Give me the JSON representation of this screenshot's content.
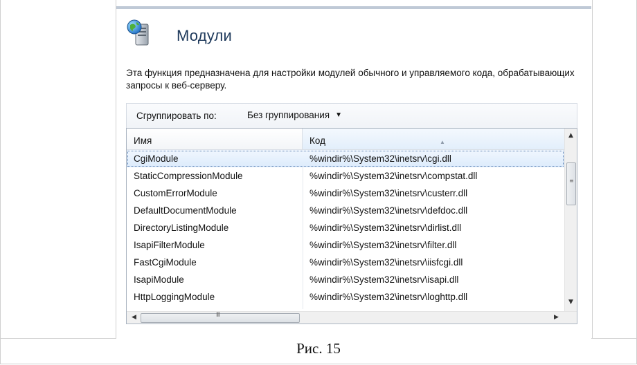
{
  "feature": {
    "title": "Модули",
    "icon": "modules-server-icon",
    "description": "Эта функция предназначена для настройки модулей обычного и управляемого кода, обрабатывающих запросы к веб-серверу."
  },
  "toolbar": {
    "group_by_label": "Сгруппировать по:",
    "group_by_value": "Без группирования"
  },
  "grid": {
    "columns": [
      "Имя",
      "Код"
    ],
    "sorted_column": "Код",
    "rows": [
      {
        "name": "CgiModule",
        "code": "%windir%\\System32\\inetsrv\\cgi.dll",
        "selected": true
      },
      {
        "name": "StaticCompressionModule",
        "code": "%windir%\\System32\\inetsrv\\compstat.dll"
      },
      {
        "name": "CustomErrorModule",
        "code": "%windir%\\System32\\inetsrv\\custerr.dll"
      },
      {
        "name": "DefaultDocumentModule",
        "code": "%windir%\\System32\\inetsrv\\defdoc.dll"
      },
      {
        "name": "DirectoryListingModule",
        "code": "%windir%\\System32\\inetsrv\\dirlist.dll"
      },
      {
        "name": "IsapiFilterModule",
        "code": "%windir%\\System32\\inetsrv\\filter.dll"
      },
      {
        "name": "FastCgiModule",
        "code": "%windir%\\System32\\inetsrv\\iisfcgi.dll"
      },
      {
        "name": "IsapiModule",
        "code": "%windir%\\System32\\inetsrv\\isapi.dll"
      },
      {
        "name": "HttpLoggingModule",
        "code": "%windir%\\System32\\inetsrv\\loghttp.dll"
      }
    ],
    "hscroll_grip": "III"
  },
  "caption": "Рис. 15"
}
